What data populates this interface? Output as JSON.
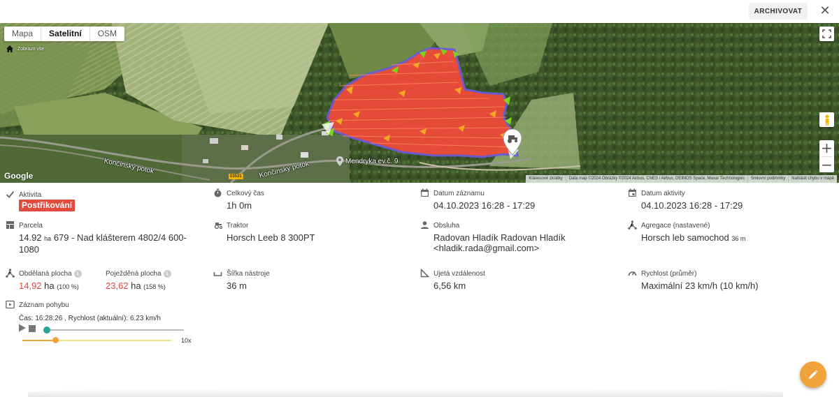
{
  "header": {
    "archive_label": "ARCHIVOVAT",
    "close_icon": "close-icon"
  },
  "map": {
    "types": [
      "Mapa",
      "Satelitní",
      "OSM"
    ],
    "active_type": "Satelitní",
    "show_all_label": "Zobrazit vše",
    "labels": {
      "road1": "Končinský potok",
      "road2": "Končinský potok",
      "poi": "Mendryka ev.č. 9",
      "road_number": "03531"
    },
    "google_logo": "Google",
    "attribution": [
      "Klávesové zkratky",
      "Data map ©2024 Obrázky ©2024 Airbus, CNES / Airbus, DEIMOS Space, Maxar Technologies",
      "Smluvní podmínky",
      "Nahlásit chybu v mapě"
    ],
    "colors": {
      "field_fill": "#ef4b3a",
      "field_border": "#6b5bd6",
      "arrows": "#f5a623",
      "edges": "#7ed321"
    }
  },
  "details": {
    "aktivita": {
      "label": "Aktivita",
      "value": "Postřikování"
    },
    "celkovy_cas": {
      "label": "Celkový čas",
      "value": "1h 0m"
    },
    "datum_zaznamu": {
      "label": "Datum záznamu",
      "value": "04.10.2023 16:28 - 17:29"
    },
    "datum_aktivity": {
      "label": "Datum aktivity",
      "value": "04.10.2023 16:28 - 17:29"
    },
    "parcela": {
      "label": "Parcela",
      "area": "14.92",
      "unit": "ha",
      "name_line1": "679 - Nad klášterem 4802/4 600-",
      "name_line2": "1080"
    },
    "traktor": {
      "label": "Traktor",
      "value": "Horsch Leeb 8 300PT"
    },
    "obsluha": {
      "label": "Obsluha",
      "line1": "Radovan Hladík Radovan Hladík",
      "line2": "<hladik.rada@gmail.com>"
    },
    "agregace": {
      "label": "Agregace (nastavené)",
      "value": "Horsch leb samochod",
      "width": "36 m"
    },
    "obdelana": {
      "label": "Obdělaná plocha",
      "value": "14,92",
      "unit": "ha",
      "pct": "(100 %)"
    },
    "pojezdena": {
      "label": "Poježděná plocha",
      "value": "23,62",
      "unit": "ha",
      "pct": "(158 %)"
    },
    "sirka": {
      "label": "Šířka nástroje",
      "value": "36 m"
    },
    "vzdalenost": {
      "label": "Ujetá vzdálenost",
      "value": "6,56 km"
    },
    "rychlost": {
      "label": "Rychlost (průměr)",
      "value": "Maximální 23 km/h (10 km/h)"
    },
    "zaznam": {
      "label": "Záznam pohybu",
      "status": "Čas: 16:28:26 , Rychlost (aktuální): 6.23 km/h",
      "speed_multiplier": "10x",
      "progress": 0.01,
      "speed_level": 0.22
    }
  }
}
